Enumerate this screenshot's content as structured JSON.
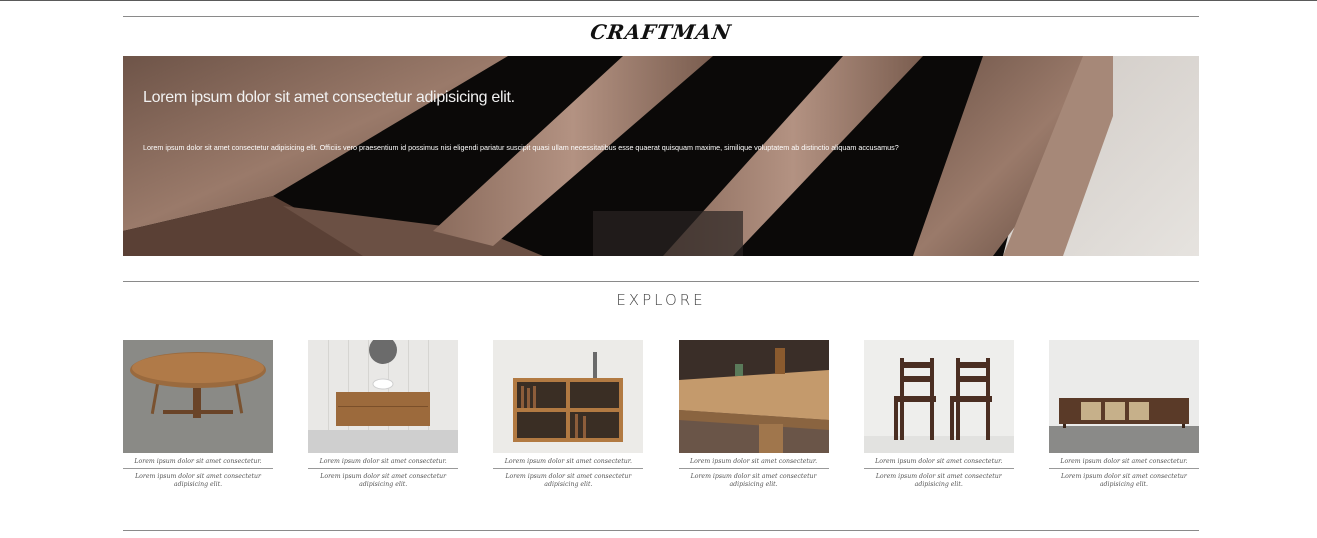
{
  "site": {
    "brand": "CRAFTMAN"
  },
  "hero": {
    "title": "Lorem ipsum dolor sit amet consectetur adipisicing elit.",
    "text": "Lorem ipsum dolor sit amet consectetur adipisicing elit. Officiis vero praesentium id possimus nisi eligendi pariatur suscipit quasi ullam necessitatibus esse quaerat quisquam maxime, similique voluptatem ab distinctio aliquam accusamus?"
  },
  "explore": {
    "heading": "EXPLORE",
    "items": [
      {
        "image": "round-table",
        "caption": "Lorem ipsum dolor sit amet consectetur.",
        "desc": "Lorem ipsum dolor sit amet consectetur adipisicing elit."
      },
      {
        "image": "bathroom-vanity",
        "caption": "Lorem ipsum dolor sit amet consectetur.",
        "desc": "Lorem ipsum dolor sit amet consectetur adipisicing elit."
      },
      {
        "image": "bookshelf",
        "caption": "Lorem ipsum dolor sit amet consectetur.",
        "desc": "Lorem ipsum dolor sit amet consectetur adipisicing elit."
      },
      {
        "image": "table-corner",
        "caption": "Lorem ipsum dolor sit amet consectetur.",
        "desc": "Lorem ipsum dolor sit amet consectetur adipisicing elit."
      },
      {
        "image": "two-chairs",
        "caption": "Lorem ipsum dolor sit amet consectetur.",
        "desc": "Lorem ipsum dolor sit amet consectetur adipisicing elit."
      },
      {
        "image": "sideboard",
        "caption": "Lorem ipsum dolor sit amet consectetur.",
        "desc": "Lorem ipsum dolor sit amet consectetur adipisicing elit."
      }
    ]
  }
}
